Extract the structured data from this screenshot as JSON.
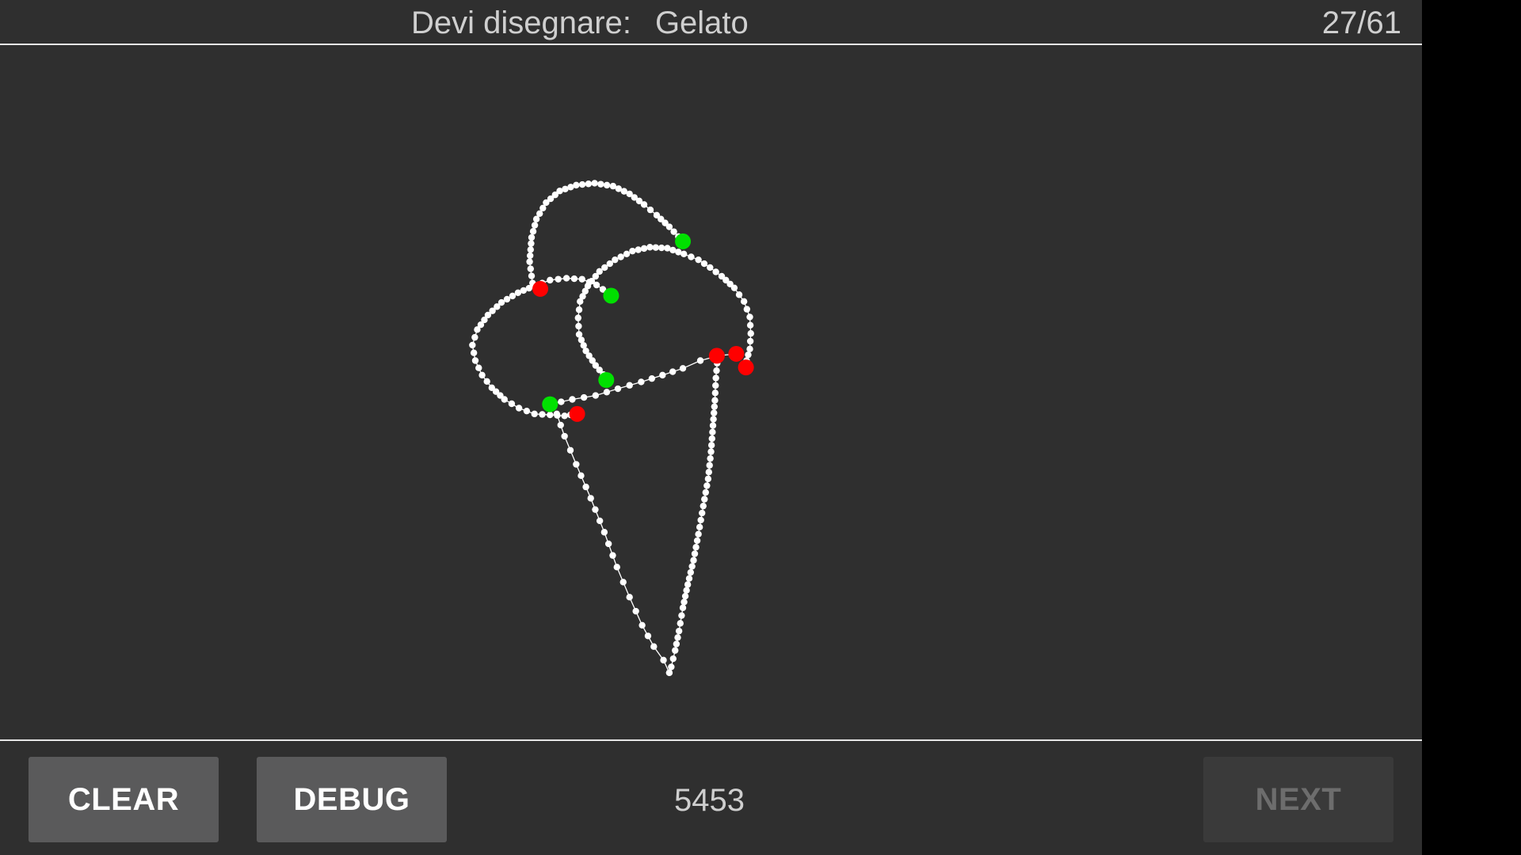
{
  "header": {
    "prompt_label": "Devi disegnare:",
    "prompt_word": "Gelato",
    "progress": "27/61"
  },
  "footer": {
    "clear_label": "CLEAR",
    "debug_label": "DEBUG",
    "score": "5453",
    "next_label": "NEXT"
  },
  "colors": {
    "background": "#2f2f2f",
    "stroke": "#ffffff",
    "start_point": "#00e000",
    "end_point": "#ff0000",
    "button": "#5a5a5b",
    "button_disabled": "#3a3a3a"
  }
}
